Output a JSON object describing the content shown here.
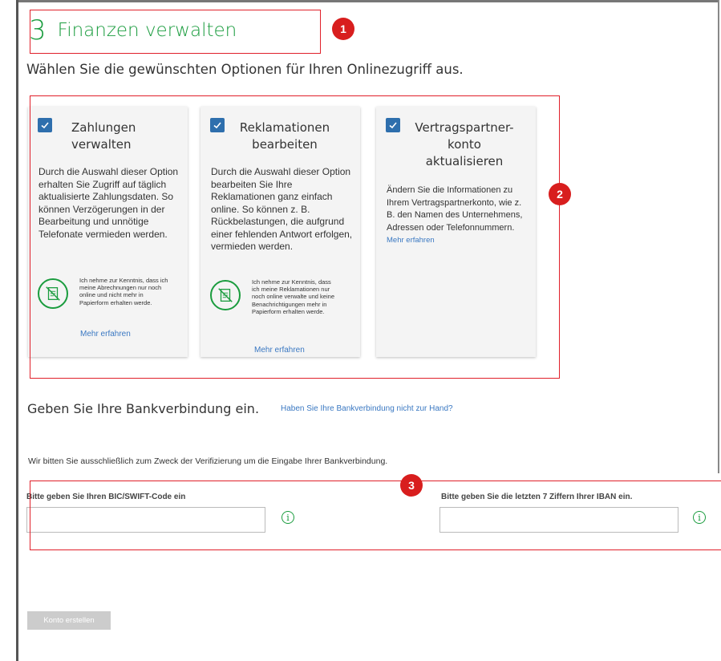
{
  "step": {
    "number": "3",
    "title": "Finanzen verwalten"
  },
  "subtitle": "Wählen Sie die gewünschten Optionen für Ihren Onlinezugriff aus.",
  "cards": [
    {
      "title": "Zahlungen verwalten",
      "checked": true,
      "description": "Durch die Auswahl dieser Option erhalten Sie Zugriff auf täglich aktualisierte Zahlungsdaten. So können Verzögerungen in der Bearbeitung und unnötige Telefonate vermieden werden.",
      "notice": "Ich nehme zur Kenntnis, dass ich meine Abrechnungen nur noch online und nicht mehr in Papierform erhalten werde.",
      "more": "Mehr erfahren"
    },
    {
      "title": "Reklamationen bearbeiten",
      "checked": true,
      "description": "Durch die Auswahl dieser Option bearbeiten Sie Ihre Reklamationen ganz einfach online. So können z. B. Rückbelastungen, die aufgrund einer fehlenden Antwort erfolgen, vermieden werden.",
      "notice": "Ich nehme zur Kenntnis, dass ich meine Reklamationen nur noch online verwalte und keine Benachrichtigungen mehr in Papierform erhalten werde.",
      "more": "Mehr erfahren"
    },
    {
      "title": "Vertragspartner-konto aktualisieren",
      "checked": true,
      "description": "Ändern Sie die Informationen zu Ihrem Vertragspartnerkonto, wie z. B. den Namen des Unternehmens, Adressen oder Telefonnummern.",
      "more": "Mehr erfahren"
    }
  ],
  "bank": {
    "heading": "Geben Sie Ihre Bankverbindung ein.",
    "help_link": "Haben Sie Ihre Bankverbindung nicht zur Hand?",
    "verify_text": "Wir bitten Sie ausschließlich zum Zweck der Verifizierung um die Eingabe Ihrer Bankverbindung.",
    "bic_label": "Bitte geben Sie Ihren BIC/SWIFT-Code ein",
    "bic_value": "",
    "iban_label": "Bitte geben Sie die letzten 7 Ziffern Ihrer IBAN ein.",
    "iban_value": ""
  },
  "submit_label": "Konto erstellen",
  "annotations": [
    "1",
    "2",
    "3"
  ],
  "colors": {
    "accent_green": "#1a9c3e",
    "checkbox_blue": "#2e6fad",
    "link_blue": "#3a78c2",
    "annotation_red": "#d81e1e"
  }
}
